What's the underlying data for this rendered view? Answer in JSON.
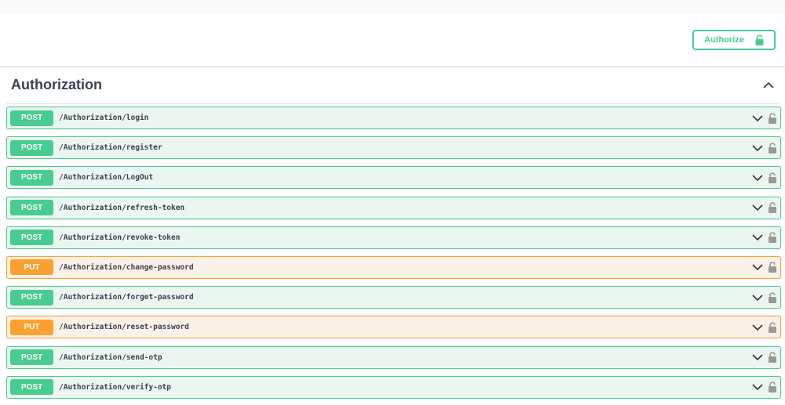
{
  "header": {
    "authorize_label": "Authorize"
  },
  "tag": {
    "title": "Authorization"
  },
  "colors": {
    "post": "#49cc90",
    "put": "#fca130"
  },
  "operations": [
    {
      "method": "POST",
      "path": "/Authorization/login"
    },
    {
      "method": "POST",
      "path": "/Authorization/register"
    },
    {
      "method": "POST",
      "path": "/Authorization/LogOut"
    },
    {
      "method": "POST",
      "path": "/Authorization/refresh-token"
    },
    {
      "method": "POST",
      "path": "/Authorization/revoke-token"
    },
    {
      "method": "PUT",
      "path": "/Authorization/change-password"
    },
    {
      "method": "POST",
      "path": "/Authorization/forget-password"
    },
    {
      "method": "PUT",
      "path": "/Authorization/reset-password"
    },
    {
      "method": "POST",
      "path": "/Authorization/send-otp"
    },
    {
      "method": "POST",
      "path": "/Authorization/verify-otp"
    }
  ]
}
